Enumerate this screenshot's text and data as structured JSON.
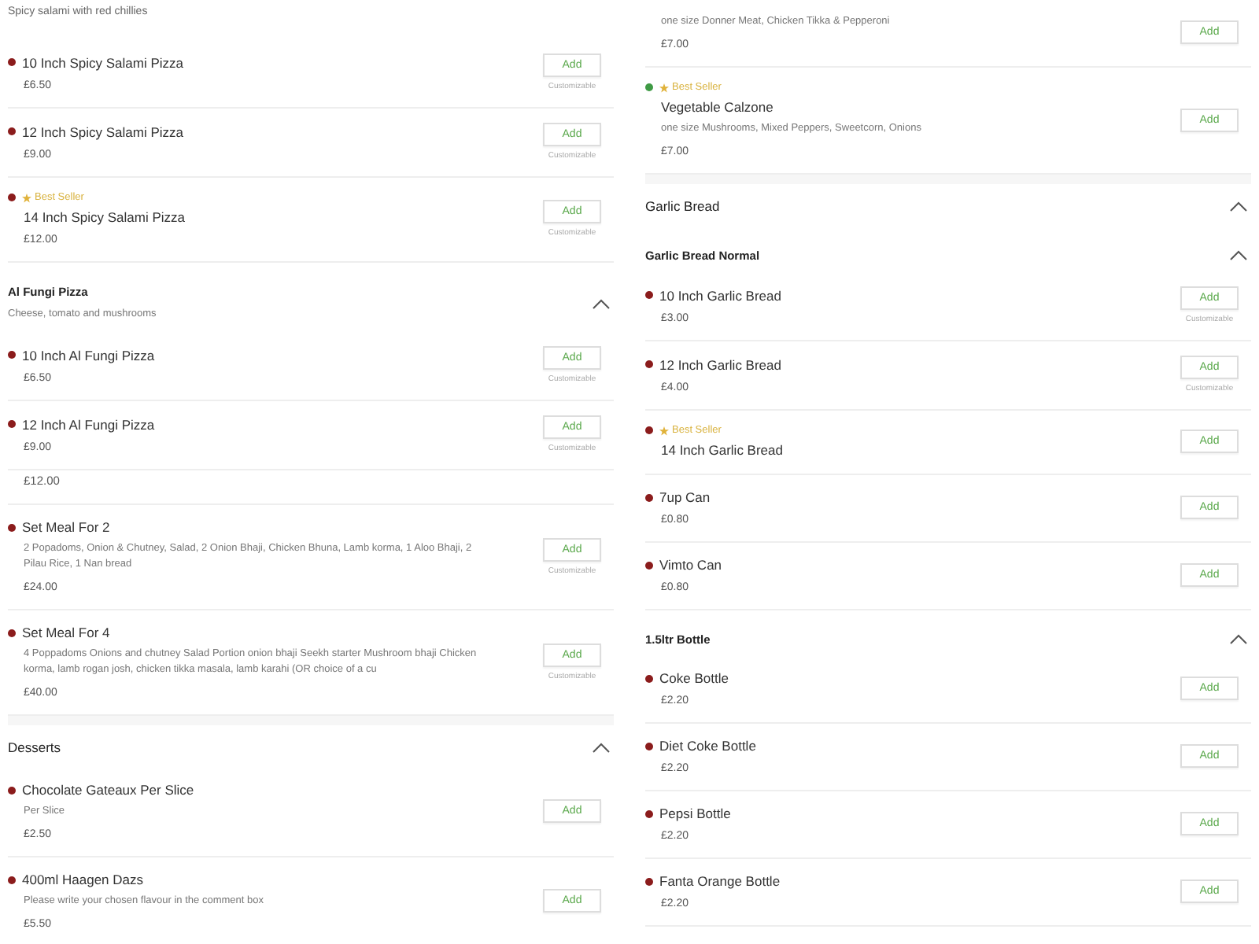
{
  "columns": [
    {
      "blocks": [
        {
          "kind": "note",
          "text": "Spicy salami with red chillies"
        },
        {
          "kind": "item",
          "color": "#8b1c1c",
          "best_seller": false,
          "name": "10 Inch Spicy Salami Pizza",
          "price": "£6.50",
          "button": "Add",
          "note": "Customizable"
        },
        {
          "kind": "item",
          "color": "#8b1c1c",
          "best_seller": false,
          "name": "12 Inch Spicy Salami Pizza",
          "price": "£9.00",
          "button": "Add",
          "note": "Customizable"
        },
        {
          "kind": "item",
          "color": "#8b1c1c",
          "best_seller": true,
          "badge": "Best Seller",
          "name": "14 Inch Spicy Salami Pizza",
          "price": "£12.00",
          "button": "Add",
          "note": "Customizable"
        },
        {
          "kind": "subcategory",
          "title": "Al Fungi Pizza",
          "description": "Cheese, tomato and mushrooms",
          "expanded": true
        },
        {
          "kind": "item",
          "color": "#8b1c1c",
          "best_seller": false,
          "name": "10 Inch Al Fungi Pizza",
          "price": "£6.50",
          "button": "Add",
          "note": "Customizable"
        },
        {
          "kind": "item",
          "color": "#8b1c1c",
          "best_seller": false,
          "name": "12 Inch Al Fungi Pizza",
          "price": "£9.00",
          "button": "Add",
          "note": "Customizable"
        },
        {
          "kind": "fragment",
          "text": "£12.00"
        },
        {
          "kind": "item",
          "color": "#8b1c1c",
          "best_seller": false,
          "name": "Set Meal For 2",
          "description": "2 Popadoms, Onion & Chutney, Salad, 2 Onion Bhaji, Chicken Bhuna, Lamb korma, 1 Aloo Bhaji, 2 Pilau Rice, 1 Nan bread",
          "price": "£24.00",
          "button": "Add",
          "note": "Customizable"
        },
        {
          "kind": "item",
          "color": "#8b1c1c",
          "best_seller": false,
          "name": "Set Meal For 4",
          "description": "4 Poppadoms Onions and chutney Salad Portion onion bhaji Seekh starter Mushroom bhaji Chicken korma, lamb rogan josh, chicken tikka masala, lamb karahi (OR choice of a cu",
          "price": "£40.00",
          "button": "Add",
          "note": "Customizable"
        },
        {
          "kind": "category",
          "title": "Desserts",
          "expanded": true
        },
        {
          "kind": "item",
          "color": "#8b1c1c",
          "best_seller": false,
          "name": "Chocolate Gateaux Per Slice",
          "description": "Per Slice",
          "price": "£2.50",
          "button": "Add"
        },
        {
          "kind": "item",
          "color": "#8b1c1c",
          "best_seller": false,
          "name": "400ml Haagen Dazs",
          "description": "Please write your chosen flavour in the comment box",
          "price": "£5.50",
          "button": "Add"
        }
      ]
    },
    {
      "blocks": [
        {
          "kind": "item",
          "best_seller": false,
          "description": "one size Donner Meat, Chicken Tikka & Pepperoni",
          "price": "£7.00",
          "button": "Add"
        },
        {
          "kind": "item",
          "color": "#3f9a45",
          "best_seller": true,
          "badge": "Best Seller",
          "name": "Vegetable Calzone",
          "description": "one size Mushrooms, Mixed Peppers, Sweetcorn, Onions",
          "price": "£7.00",
          "button": "Add"
        },
        {
          "kind": "category",
          "title": "Garlic Bread",
          "expanded": true
        },
        {
          "kind": "subcategory",
          "title": "Garlic Bread Normal",
          "expanded": true
        },
        {
          "kind": "item",
          "color": "#8b1c1c",
          "best_seller": false,
          "name": "10 Inch Garlic Bread",
          "price": "£3.00",
          "button": "Add",
          "note": "Customizable"
        },
        {
          "kind": "item",
          "color": "#8b1c1c",
          "best_seller": false,
          "name": "12 Inch Garlic Bread",
          "price": "£4.00",
          "button": "Add",
          "note": "Customizable"
        },
        {
          "kind": "item",
          "color": "#8b1c1c",
          "best_seller": true,
          "badge": "Best Seller",
          "name": "14 Inch Garlic Bread",
          "button": "Add"
        },
        {
          "kind": "item",
          "color": "#8b1c1c",
          "best_seller": false,
          "name": "7up Can",
          "price": "£0.80",
          "button": "Add"
        },
        {
          "kind": "item",
          "color": "#8b1c1c",
          "best_seller": false,
          "name": "Vimto Can",
          "price": "£0.80",
          "button": "Add"
        },
        {
          "kind": "subcategory",
          "title": "1.5ltr Bottle",
          "expanded": true
        },
        {
          "kind": "item",
          "color": "#8b1c1c",
          "best_seller": false,
          "name": "Coke Bottle",
          "price": "£2.20",
          "button": "Add"
        },
        {
          "kind": "item",
          "color": "#8b1c1c",
          "best_seller": false,
          "name": "Diet Coke Bottle",
          "price": "£2.20",
          "button": "Add"
        },
        {
          "kind": "item",
          "color": "#8b1c1c",
          "best_seller": false,
          "name": "Pepsi Bottle",
          "price": "£2.20",
          "button": "Add"
        },
        {
          "kind": "item",
          "color": "#8b1c1c",
          "best_seller": false,
          "name": "Fanta Orange Bottle",
          "price": "£2.20",
          "button": "Add"
        }
      ]
    }
  ]
}
